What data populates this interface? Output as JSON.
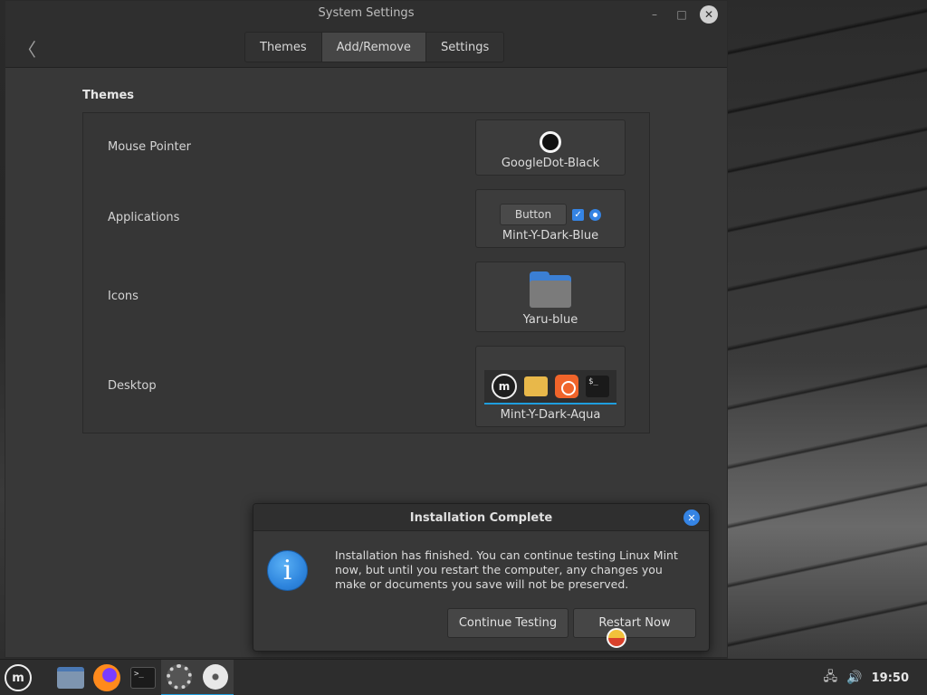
{
  "window": {
    "title": "System Settings",
    "back_icon": "back-chevron-icon",
    "controls": {
      "minimize": "–",
      "maximize": "□",
      "close": "✕"
    }
  },
  "tabs": [
    {
      "label": "Themes"
    },
    {
      "label": "Add/Remove",
      "active": true
    },
    {
      "label": "Settings"
    }
  ],
  "themes": {
    "section_title": "Themes",
    "rows": [
      {
        "label": "Mouse Pointer",
        "value": "GoogleDot-Black"
      },
      {
        "label": "Applications",
        "value": "Mint-Y-Dark-Blue",
        "preview_button": "Button"
      },
      {
        "label": "Icons",
        "value": "Yaru-blue"
      },
      {
        "label": "Desktop",
        "value": "Mint-Y-Dark-Aqua",
        "term_text": "$_"
      }
    ]
  },
  "dialog": {
    "title": "Installation Complete",
    "message": "Installation has finished.  You can continue testing Linux Mint now, but until you restart the computer, any changes you make or documents you save will not be preserved.",
    "continue_label": "Continue Testing",
    "restart_label": "Restart Now",
    "info_glyph": "i",
    "close_glyph": "✕"
  },
  "taskbar": {
    "menu_glyph": "m",
    "term_glyph": ">_",
    "clock": "19:50",
    "network_glyph": "🖧",
    "volume_glyph": "🔊"
  },
  "colors": {
    "accent": "#3584e4",
    "panel_highlight": "#1f9ede",
    "window_bg": "#383838"
  }
}
